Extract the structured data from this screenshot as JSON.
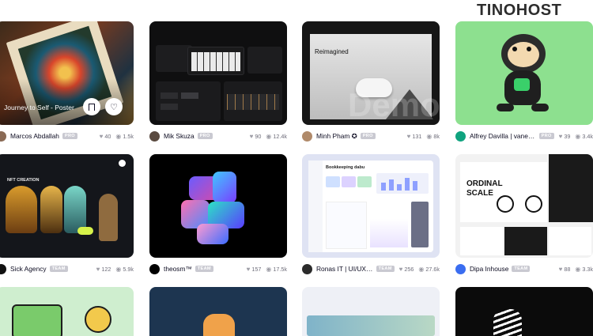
{
  "brand": {
    "logo_text": "TINOHOST"
  },
  "shots": [
    {
      "author": "Marcos Abdallah",
      "badge": "PRO",
      "likes": "40",
      "views": "1.5k",
      "overlay_title": "Journey to Self - Poster"
    },
    {
      "author": "Mik Skuza",
      "badge": "PRO",
      "likes": "90",
      "views": "12.4k"
    },
    {
      "author": "Minh Pham ✪",
      "badge": "PRO",
      "likes": "131",
      "views": "8k",
      "hero_title": "Reimagined",
      "watermark": "Demo"
    },
    {
      "author": "Alfrey Davilla | vaneltia",
      "badge": "PRO",
      "likes": "39",
      "views": "3.4k"
    },
    {
      "author": "Sick Agency",
      "badge": "TEAM",
      "likes": "122",
      "views": "5.9k",
      "nft_title": "NFT CREATION"
    },
    {
      "author": "theosm™",
      "badge": "TEAM",
      "likes": "157",
      "views": "17.5k"
    },
    {
      "author": "Ronas IT | UI/UX T...",
      "badge": "TEAM",
      "likes": "256",
      "views": "27.6k",
      "dash_title": "Bookkeeping dabu"
    },
    {
      "author": "Dipa Inhouse",
      "badge": "TEAM",
      "likes": "88",
      "views": "3.3k",
      "hero_line1": "ORDINAL",
      "hero_line2": "SCALE"
    }
  ]
}
